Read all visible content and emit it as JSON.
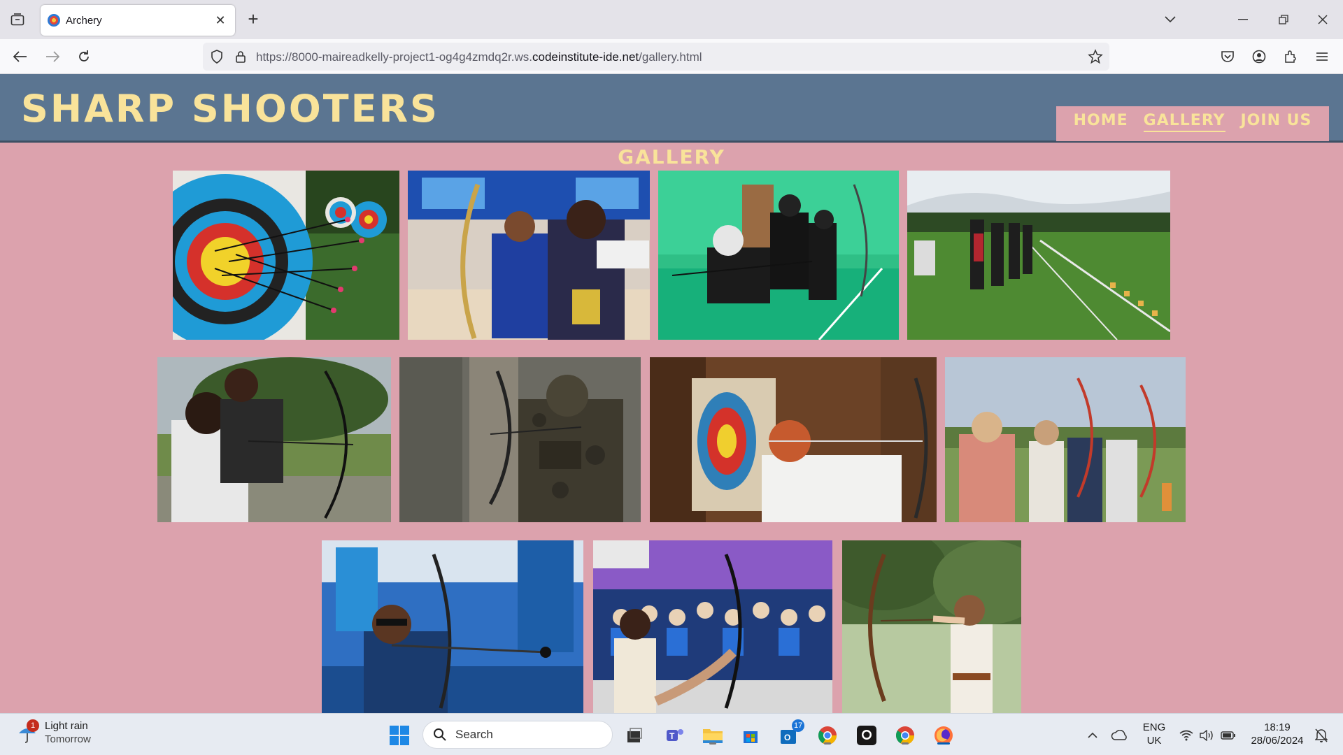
{
  "browser": {
    "tab_title": "Archery",
    "url_prefix": "https://8000-maireadkelly-project1-og4g4zmdq2r.ws.",
    "url_host": "codeinstitute-ide.net",
    "url_path": "/gallery.html"
  },
  "site": {
    "logo": "SHARP SHOOTERS",
    "nav": [
      {
        "label": "HOME"
      },
      {
        "label": "GALLERY",
        "active": true
      },
      {
        "label": "JOIN US"
      }
    ],
    "page_title": "GALLERY",
    "colors": {
      "header": "#5b7591",
      "background": "#dca2ad",
      "accent": "#f9e39a"
    }
  },
  "gallery": {
    "images": [
      {
        "subject": "archery target with arrows"
      },
      {
        "subject": "children drawing recurve bows indoors"
      },
      {
        "subject": "indoor archers in green hall"
      },
      {
        "subject": "archers lined up on field"
      },
      {
        "subject": "young archers outdoors"
      },
      {
        "subject": "camouflaged hunter with compound bow"
      },
      {
        "subject": "archer aiming at target in barn"
      },
      {
        "subject": "group of archers outdoors"
      },
      {
        "subject": "compound archer competition"
      },
      {
        "subject": "foot archer at competition"
      },
      {
        "subject": "woman with longbow in forest"
      }
    ]
  },
  "taskbar": {
    "weather_title": "Light rain",
    "weather_sub": "Tomorrow",
    "weather_badge": "1",
    "search_label": "Search",
    "outlook_badge": "17",
    "lang_top": "ENG",
    "lang_bottom": "UK",
    "time": "18:19",
    "date": "28/06/2024"
  }
}
